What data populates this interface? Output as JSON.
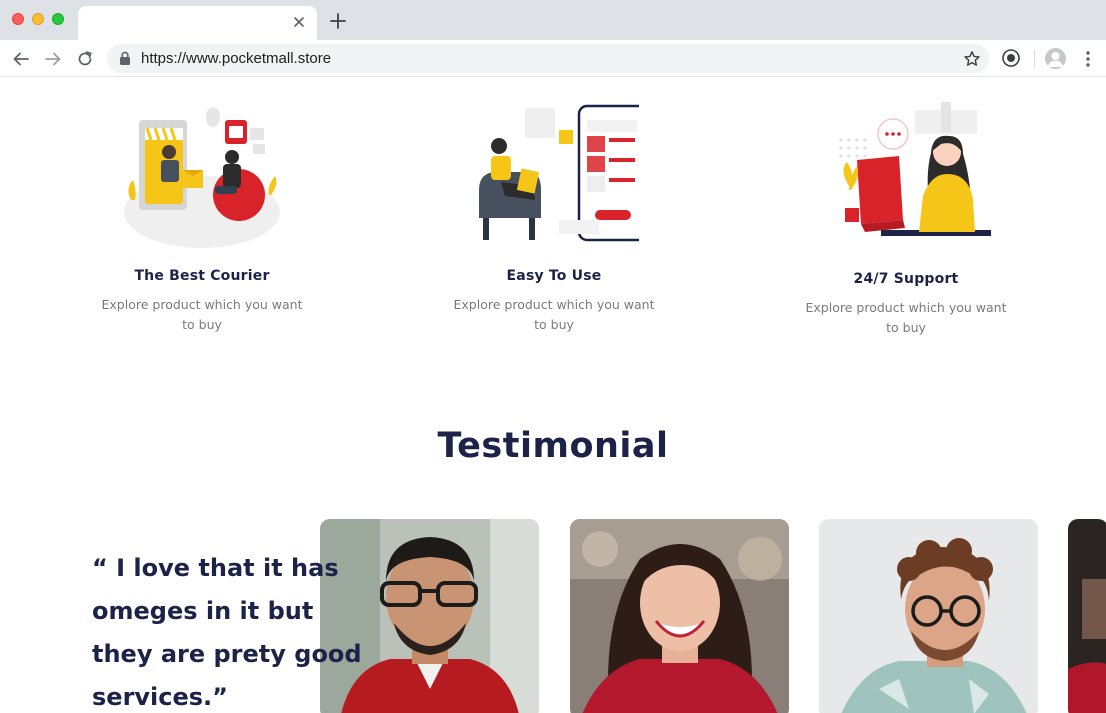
{
  "browser": {
    "url": "https://www.pocketmall.store",
    "tab_title": ""
  },
  "features": [
    {
      "title": "The Best Courier",
      "description": "Explore product which you want to buy",
      "illustration": "courier-delivery-illustration"
    },
    {
      "title": "Easy To Use",
      "description": "Explore product which you want to buy",
      "illustration": "mobile-shopping-illustration"
    },
    {
      "title": "24/7 Support",
      "description": "Explore product which you want to buy",
      "illustration": "customer-support-illustration"
    }
  ],
  "testimonial": {
    "section_title": "Testimonial",
    "quote": "“ I love that it has omeges in it but they are prety good services.”",
    "photos": [
      "man-with-glasses-red-shirt",
      "smiling-woman-red-top",
      "curly-haired-man-glasses",
      "partial-fourth-photo"
    ]
  },
  "colors": {
    "heading": "#1d2248",
    "muted_text": "#7a7a7a",
    "accent_red": "#d8232a",
    "accent_yellow": "#f5c518"
  }
}
